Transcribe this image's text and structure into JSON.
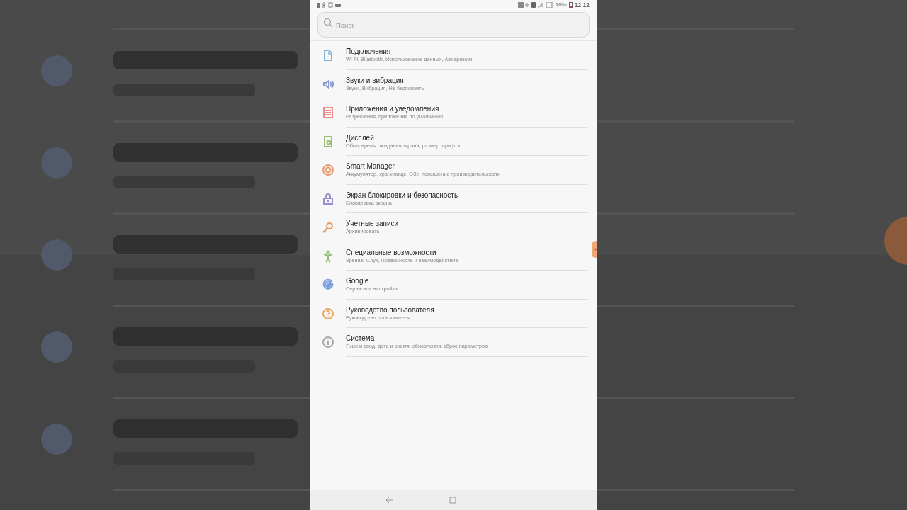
{
  "status_bar": {
    "battery": "10%",
    "time": "12:12"
  },
  "search": {
    "placeholder": "Поиск"
  },
  "items": [
    {
      "kind": "connections",
      "color": "#7fb6e0",
      "title": "Подключения",
      "subtitle": "Wi-Fi, Bluetooth, Использование данных, Авиарежим"
    },
    {
      "kind": "sound",
      "color": "#8a9ad6",
      "title": "Звуки и вибрация",
      "subtitle": "Звуки, Вибрация, Не беспокоить"
    },
    {
      "kind": "apps",
      "color": "#e8908a",
      "title": "Приложения и уведомления",
      "subtitle": "Разрешения, приложения по умолчанию"
    },
    {
      "kind": "display",
      "color": "#9cc06a",
      "title": "Дисплей",
      "subtitle": "Обои, время ожидания экрана, размер шрифта"
    },
    {
      "kind": "manager",
      "color": "#eb9a6a",
      "title": "Smart Manager",
      "subtitle": "Аккумулятор, хранилище, ОЗУ, повышение производительности"
    },
    {
      "kind": "lock",
      "color": "#9a8ed0",
      "title": "Экран блокировки и безопасность",
      "subtitle": "Блокировка экрана"
    },
    {
      "kind": "key",
      "color": "#e89a60",
      "title": "Учетные записи",
      "subtitle": "Архивировать"
    },
    {
      "kind": "accessibility",
      "color": "#8cc070",
      "title": "Специальные возможности",
      "subtitle": "Зрение, Слух, Подвижность и взаимодействие"
    },
    {
      "kind": "google",
      "color": "#7a9ee0",
      "title": "Google",
      "subtitle": "Сервисы и настройки"
    },
    {
      "kind": "help",
      "color": "#e8a860",
      "title": "Руководство пользователя",
      "subtitle": "Руководство пользователя"
    },
    {
      "kind": "info",
      "color": "#a8a8a8",
      "title": "Система",
      "subtitle": "Язык и ввод, дата и время, обновления, сброс параметров"
    }
  ]
}
